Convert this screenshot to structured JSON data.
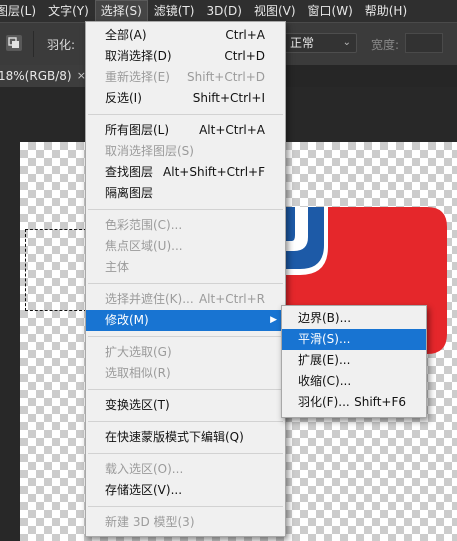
{
  "menubar": {
    "items": [
      "图层(L)",
      "文字(Y)",
      "选择(S)",
      "滤镜(T)",
      "3D(D)",
      "视图(V)",
      "窗口(W)",
      "帮助(H)"
    ]
  },
  "options_bar": {
    "feather_label": "羽化:",
    "style_value": "正常",
    "width_label": "宽度:"
  },
  "document_tab": {
    "title": "18%(RGB/8)",
    "close": "×"
  },
  "select_menu": {
    "items": [
      {
        "label": "全部(A)",
        "shortcut": "Ctrl+A",
        "disabled": false
      },
      {
        "label": "取消选择(D)",
        "shortcut": "Ctrl+D",
        "disabled": false
      },
      {
        "label": "重新选择(E)",
        "shortcut": "Shift+Ctrl+D",
        "disabled": true
      },
      {
        "label": "反选(I)",
        "shortcut": "Shift+Ctrl+I",
        "disabled": false
      },
      {
        "label": "所有图层(L)",
        "shortcut": "Alt+Ctrl+A",
        "disabled": false
      },
      {
        "label": "取消选择图层(S)",
        "shortcut": "",
        "disabled": true
      },
      {
        "label": "查找图层",
        "shortcut": "Alt+Shift+Ctrl+F",
        "disabled": false
      },
      {
        "label": "隔离图层",
        "shortcut": "",
        "disabled": false
      },
      {
        "label": "色彩范围(C)...",
        "shortcut": "",
        "disabled": true
      },
      {
        "label": "焦点区域(U)...",
        "shortcut": "",
        "disabled": true
      },
      {
        "label": "主体",
        "shortcut": "",
        "disabled": true
      },
      {
        "label": "选择并遮住(K)...",
        "shortcut": "Alt+Ctrl+R",
        "disabled": true
      },
      {
        "label": "修改(M)",
        "shortcut": "",
        "disabled": false
      },
      {
        "label": "扩大选取(G)",
        "shortcut": "",
        "disabled": true
      },
      {
        "label": "选取相似(R)",
        "shortcut": "",
        "disabled": true
      },
      {
        "label": "变换选区(T)",
        "shortcut": "",
        "disabled": false
      },
      {
        "label": "在快速蒙版模式下编辑(Q)",
        "shortcut": "",
        "disabled": false
      },
      {
        "label": "载入选区(O)...",
        "shortcut": "",
        "disabled": true
      },
      {
        "label": "存储选区(V)...",
        "shortcut": "",
        "disabled": false
      },
      {
        "label": "新建 3D 模型(3)",
        "shortcut": "",
        "disabled": true
      }
    ],
    "submenu_arrow": "▶"
  },
  "modify_submenu": {
    "items": [
      {
        "label": "边界(B)...",
        "shortcut": ""
      },
      {
        "label": "平滑(S)...",
        "shortcut": ""
      },
      {
        "label": "扩展(E)...",
        "shortcut": ""
      },
      {
        "label": "收缩(C)...",
        "shortcut": ""
      },
      {
        "label": "羽化(F)...",
        "shortcut": "Shift+F6"
      }
    ]
  },
  "colors": {
    "menu_highlight": "#1874d2",
    "artwork_red": "#e5272b",
    "artwork_blue": "#1d5aa7"
  }
}
